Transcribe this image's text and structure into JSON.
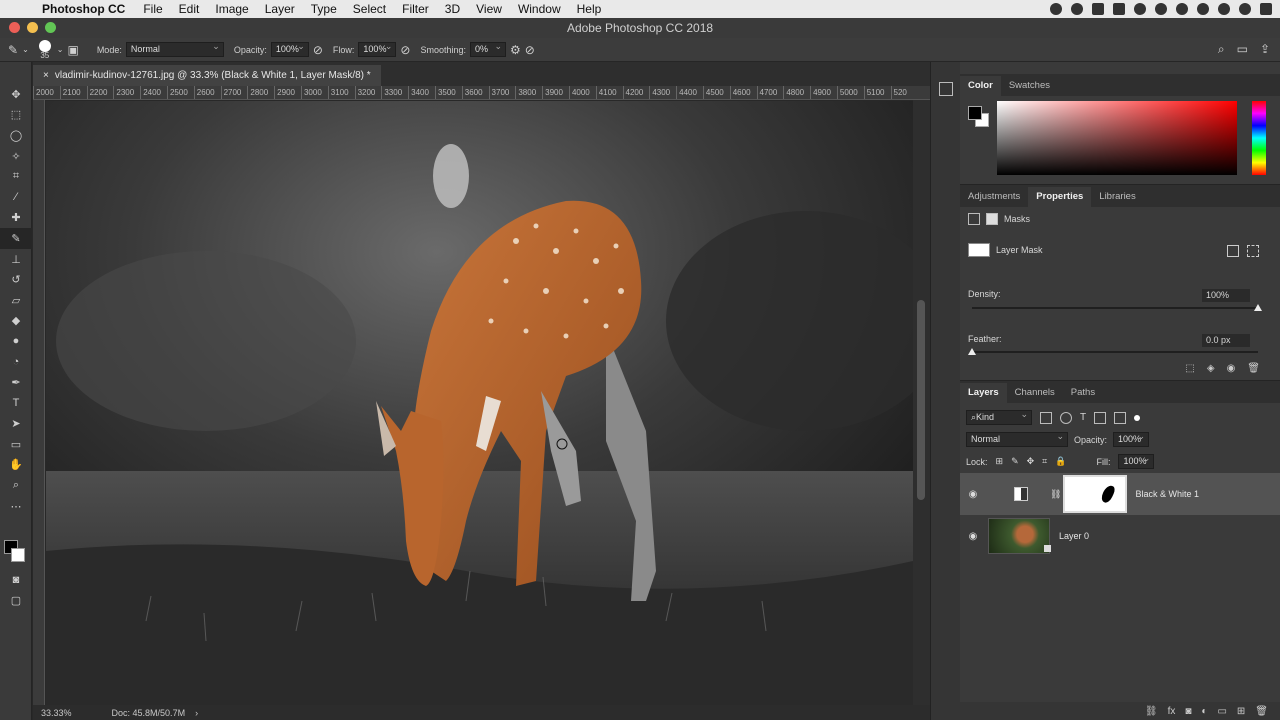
{
  "menubar": {
    "app_name": "Photoshop CC",
    "items": [
      "File",
      "Edit",
      "Image",
      "Layer",
      "Type",
      "Select",
      "Filter",
      "3D",
      "View",
      "Window",
      "Help"
    ]
  },
  "window": {
    "title": "Adobe Photoshop CC 2018"
  },
  "options": {
    "brush_size": "35",
    "mode_label": "Mode:",
    "mode_value": "Normal",
    "opacity_label": "Opacity:",
    "opacity_value": "100%",
    "flow_label": "Flow:",
    "flow_value": "100%",
    "smoothing_label": "Smoothing:",
    "smoothing_value": "0%"
  },
  "document": {
    "tab_title": "vladimir-kudinov-12761.jpg @ 33.3% (Black & White 1, Layer Mask/8) *",
    "ruler_ticks": [
      "2000",
      "2100",
      "2200",
      "2300",
      "2400",
      "2500",
      "2600",
      "2700",
      "2800",
      "2900",
      "3000",
      "3100",
      "3200",
      "3300",
      "3400",
      "3500",
      "3600",
      "3700",
      "3800",
      "3900",
      "4000",
      "4100",
      "4200",
      "4300",
      "4400",
      "4500",
      "4600",
      "4700",
      "4800",
      "4900",
      "5000",
      "5100",
      "520"
    ],
    "zoom": "33.33%",
    "doc_size": "Doc: 45.8M/50.7M"
  },
  "color_panel": {
    "tabs": [
      "Color",
      "Swatches"
    ]
  },
  "properties_panel": {
    "tabs": [
      "Adjustments",
      "Properties",
      "Libraries"
    ],
    "masks_label": "Masks",
    "layer_mask_label": "Layer Mask",
    "density_label": "Density:",
    "density_value": "100%",
    "density_level": 1.0,
    "feather_label": "Feather:",
    "feather_value": "0.0 px",
    "feather_level": 0.0
  },
  "layers_panel": {
    "tabs": [
      "Layers",
      "Channels",
      "Paths"
    ],
    "kind_label": "Kind",
    "blend_mode": "Normal",
    "opacity_label": "Opacity:",
    "opacity_value": "100%",
    "lock_label": "Lock:",
    "fill_label": "Fill:",
    "fill_value": "100%",
    "layers": [
      {
        "name": "Black & White 1",
        "selected": true
      },
      {
        "name": "Layer 0",
        "selected": false
      }
    ]
  },
  "colors": {
    "panel_bg": "#3a3a3a",
    "selected_layer": "#535353",
    "deer_orange": "#c06a2e"
  }
}
